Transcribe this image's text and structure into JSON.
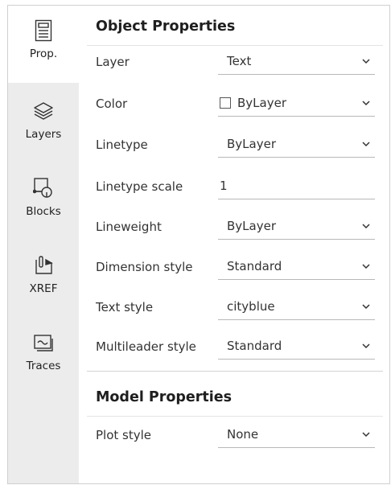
{
  "sidebar": {
    "tabs": [
      {
        "label": "Prop.",
        "icon": "properties-icon",
        "active": true
      },
      {
        "label": "Layers",
        "icon": "layers-icon",
        "active": false
      },
      {
        "label": "Blocks",
        "icon": "blocks-icon",
        "active": false
      },
      {
        "label": "XREF",
        "icon": "xref-icon",
        "active": false
      },
      {
        "label": "Traces",
        "icon": "traces-icon",
        "active": false
      }
    ]
  },
  "object_properties": {
    "title": "Object Properties",
    "rows": [
      {
        "label": "Layer",
        "value": "Text"
      },
      {
        "label": "Color",
        "value": "ByLayer"
      },
      {
        "label": "Linetype",
        "value": "ByLayer"
      },
      {
        "label": "Linetype scale",
        "value": "1"
      },
      {
        "label": "Lineweight",
        "value": "ByLayer"
      },
      {
        "label": "Dimension style",
        "value": "Standard"
      },
      {
        "label": "Text style",
        "value": "cityblue"
      },
      {
        "label": "Multileader style",
        "value": "Standard"
      }
    ]
  },
  "model_properties": {
    "title": "Model Properties",
    "rows": [
      {
        "label": "Plot style",
        "value": "None"
      }
    ]
  },
  "colors": {
    "sidebar_bg": "#ececec",
    "active_tab_bg": "#ffffff",
    "text": "#333333"
  }
}
